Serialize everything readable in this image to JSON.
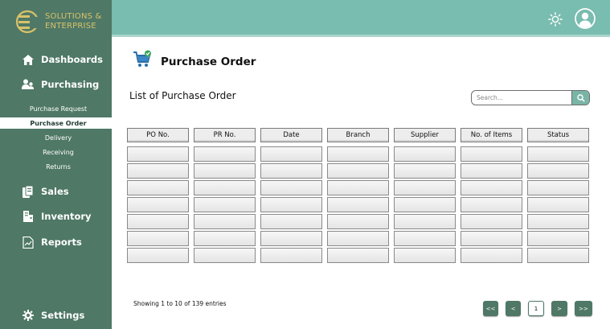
{
  "brand": {
    "line1": "SOLUTIONS &",
    "line2": "ENTERPRISE",
    "gold": "#d8c26a"
  },
  "colors": {
    "sidebar": "#4f7866",
    "header": "#79bcb0",
    "accent": "#79b5a7"
  },
  "sidebar": {
    "items": [
      {
        "label": "Dashboards",
        "icon": "home-icon"
      },
      {
        "label": "Purchasing",
        "icon": "users-icon"
      },
      {
        "label": "Sales",
        "icon": "document-icon"
      },
      {
        "label": "Inventory",
        "icon": "building-icon"
      },
      {
        "label": "Reports",
        "icon": "chart-icon"
      },
      {
        "label": "Settings",
        "icon": "gear-icon"
      }
    ],
    "subitems": [
      "Purchase Request",
      "Purchase Order",
      "Delivery",
      "Receiving",
      "Returns"
    ],
    "active_subitem": "Purchase Order"
  },
  "header": {
    "theme_icon": "sun-icon",
    "user_icon": "user-avatar-icon"
  },
  "main": {
    "page_title": "Purchase Order",
    "page_icon": "cart-icon",
    "list_title": "List of Purchase Order",
    "search": {
      "placeholder": "Search...",
      "value": "",
      "icon": "search-icon"
    },
    "table": {
      "columns": [
        "PO  No.",
        "PR No.",
        "Date",
        "Branch",
        "Supplier",
        "No. of Items",
        "Status"
      ],
      "rows": [
        [
          "",
          "",
          "",
          "",
          "",
          "",
          ""
        ],
        [
          "",
          "",
          "",
          "",
          "",
          "",
          ""
        ],
        [
          "",
          "",
          "",
          "",
          "",
          "",
          ""
        ],
        [
          "",
          "",
          "",
          "",
          "",
          "",
          ""
        ],
        [
          "",
          "",
          "",
          "",
          "",
          "",
          ""
        ],
        [
          "",
          "",
          "",
          "",
          "",
          "",
          ""
        ],
        [
          "",
          "",
          "",
          "",
          "",
          "",
          ""
        ]
      ]
    },
    "entries_text": "Showing 1 to 10 of 139 entries",
    "pagination": {
      "first": "<<",
      "prev": "<",
      "current": "1",
      "next": ">",
      "last": ">>"
    }
  }
}
